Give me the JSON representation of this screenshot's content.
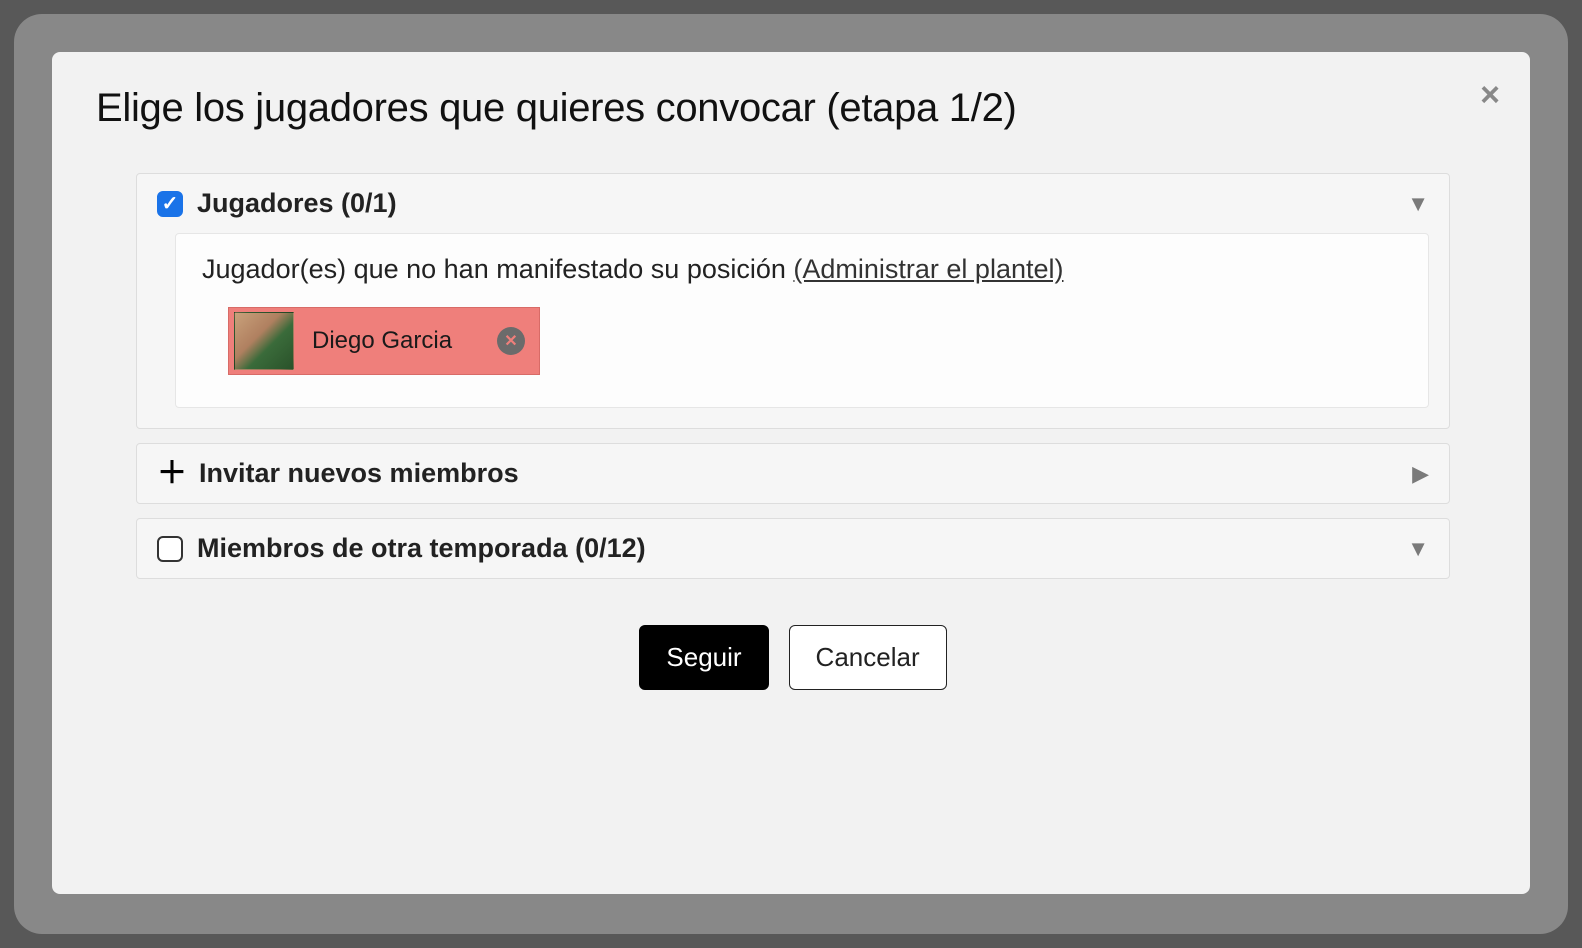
{
  "modal": {
    "title": "Elige los jugadores que quieres convocar (etapa 1/2)",
    "close_glyph": "×"
  },
  "panels": {
    "players": {
      "label": "Jugadores (0/1)",
      "checked": true,
      "body_heading_prefix": "Jugador(es) que no han manifestado su posición ",
      "manage_link": "(Administrar el plantel)",
      "items": [
        {
          "name": "Diego Garcia"
        }
      ]
    },
    "invite": {
      "label": "Invitar nuevos miembros"
    },
    "other_season": {
      "label": "Miembros de otra temporada (0/12)",
      "checked": false
    }
  },
  "actions": {
    "primary": "Seguir",
    "secondary": "Cancelar"
  }
}
